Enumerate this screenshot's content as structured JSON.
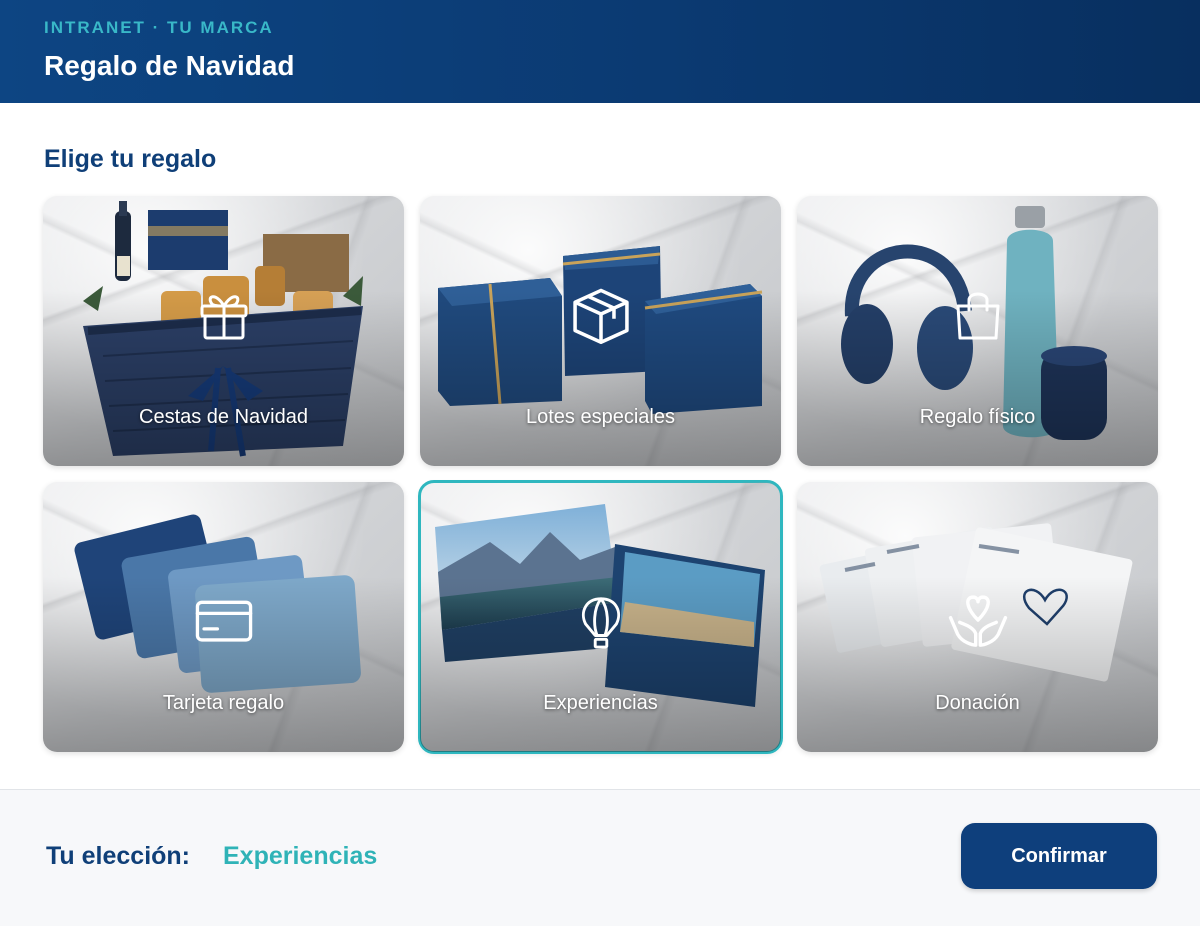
{
  "header": {
    "eyebrow": "INTRANET · TU MARCA",
    "title": "Regalo de Navidad"
  },
  "main": {
    "section_title": "Elige tu regalo",
    "options": [
      {
        "label": "Cestas de Navidad",
        "icon": "gift-icon",
        "selected": false
      },
      {
        "label": "Lotes especiales",
        "icon": "box-icon",
        "selected": false
      },
      {
        "label": "Regalo físico",
        "icon": "shopping-bag-icon",
        "selected": false
      },
      {
        "label": "Tarjeta regalo",
        "icon": "credit-card-icon",
        "selected": false
      },
      {
        "label": "Experiencias",
        "icon": "hot-air-balloon-icon",
        "selected": true
      },
      {
        "label": "Donación",
        "icon": "heart-hands-icon",
        "selected": false
      }
    ]
  },
  "footer": {
    "choice_label": "Tu elección:",
    "choice_value": "Experiencias",
    "confirm_label": "Confirmar"
  },
  "colors": {
    "brand_navy": "#0e3f7c",
    "accent_teal": "#2fb7bf",
    "eyebrow_teal": "#39b8c8"
  }
}
